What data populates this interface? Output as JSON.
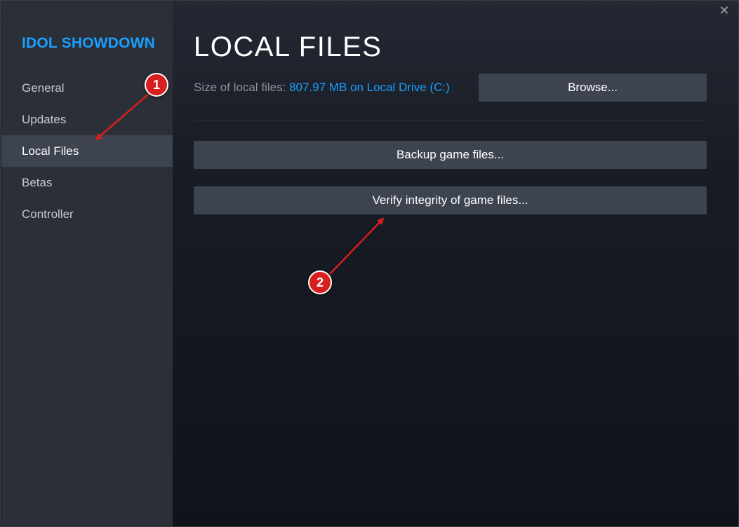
{
  "sidebar": {
    "game_title": "IDOL SHOWDOWN",
    "items": [
      {
        "label": "General"
      },
      {
        "label": "Updates"
      },
      {
        "label": "Local Files"
      },
      {
        "label": "Betas"
      },
      {
        "label": "Controller"
      }
    ],
    "active_index": 2
  },
  "window": {
    "close_glyph": "✕"
  },
  "main": {
    "title": "LOCAL FILES",
    "size_label": "Size of local files:",
    "size_value": "807.97 MB on Local Drive (C:)",
    "browse_label": "Browse...",
    "backup_label": "Backup game files...",
    "verify_label": "Verify integrity of game files..."
  },
  "annotations": {
    "marker_1": "1",
    "marker_2": "2"
  },
  "colors": {
    "accent": "#1a9fff",
    "sidebar_bg": "#2b2f37",
    "active_bg": "#3d4450",
    "button_bg": "#3d4450",
    "marker_red": "#d71f1f"
  }
}
